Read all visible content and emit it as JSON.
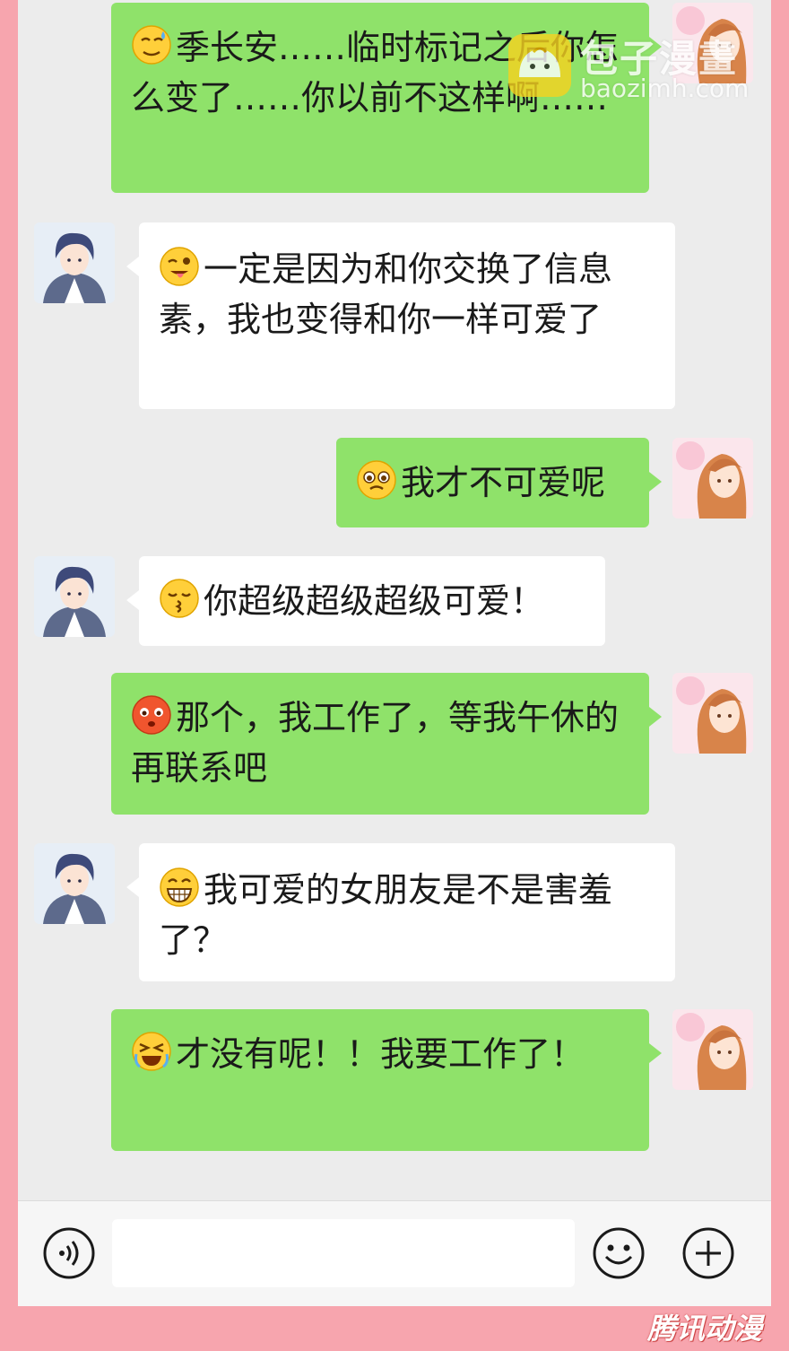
{
  "messages": [
    {
      "side": "me",
      "emoji": "sweat-smile-emoji",
      "text": "季长安……临时标记之后你怎么变了……你以前不这样啊……"
    },
    {
      "side": "him",
      "emoji": "wink-tongue-emoji",
      "text": "一定是因为和你交换了信息素，我也变得和你一样可爱了"
    },
    {
      "side": "me",
      "emoji": "pleading-emoji",
      "text": "我才不可爱呢"
    },
    {
      "side": "him",
      "emoji": "kissing-emoji",
      "text": "你超级超级超级可爱！"
    },
    {
      "side": "me",
      "emoji": "blushing-angry-emoji",
      "text": "那个，我工作了，等我午休的再联系吧"
    },
    {
      "side": "him",
      "emoji": "grinning-teeth-emoji",
      "text": "我可爱的女朋友是不是害羞了？"
    },
    {
      "side": "me",
      "emoji": "crying-loudly-emoji",
      "text": "才没有呢！！我要工作了！"
    }
  ],
  "input_bar": {
    "voice_icon": "voice-icon",
    "emoji_icon": "smiley-icon",
    "add_icon": "plus-icon",
    "text_value": ""
  },
  "watermark": {
    "main": "包子漫畫",
    "sub": "baozimh.com"
  },
  "corner_logo": {
    "text": "腾讯动漫"
  },
  "colors": {
    "background": "#f7a5ae",
    "chat_bg": "#ececec",
    "my_bubble": "#8fe26a",
    "his_bubble": "#ffffff"
  }
}
